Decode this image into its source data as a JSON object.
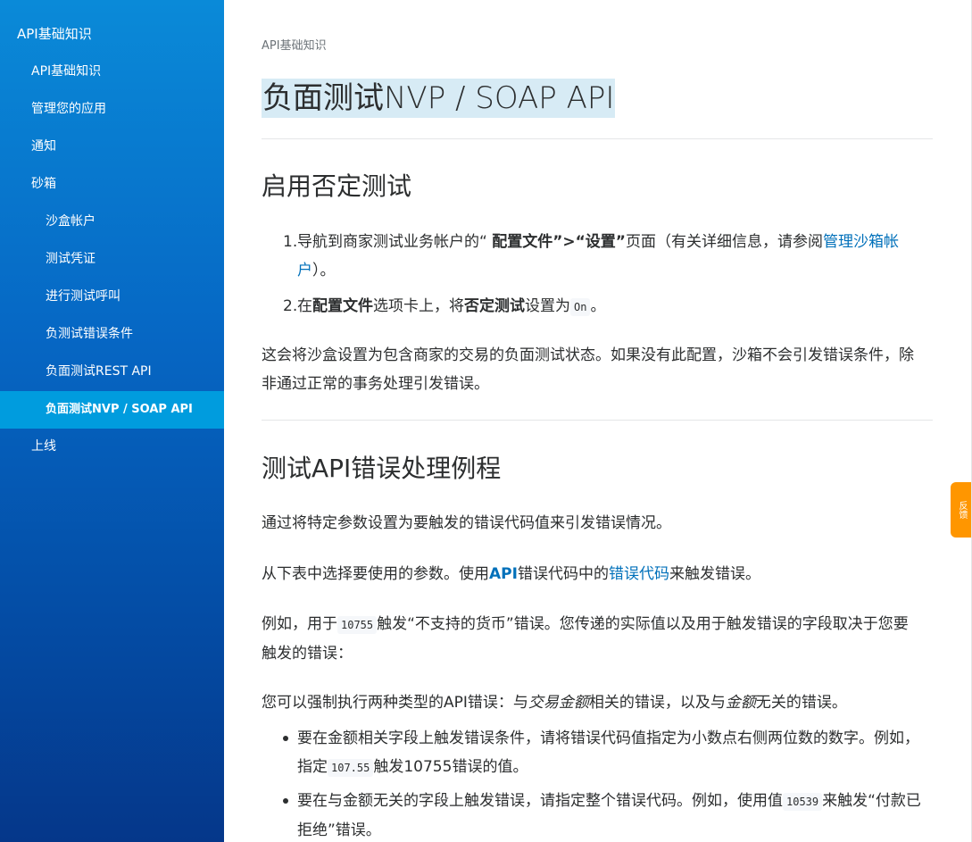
{
  "sidebar": {
    "items": [
      {
        "label": "API基础知识"
      },
      {
        "label": "API基础知识"
      },
      {
        "label": "管理您的应用"
      },
      {
        "label": "通知"
      },
      {
        "label": "砂箱"
      },
      {
        "label": "沙盒帐户"
      },
      {
        "label": "测试凭证"
      },
      {
        "label": "进行测试呼叫"
      },
      {
        "label": "负测试错误条件"
      },
      {
        "label": "负面测试REST API"
      },
      {
        "label": "负面测试NVP / SOAP API"
      },
      {
        "label": "上线"
      }
    ]
  },
  "main": {
    "breadcrumb": "API基础知识",
    "title_cjk": "负面测试",
    "title_en": "NVP / SOAP API",
    "section1": {
      "heading": "启用否定测试",
      "step1": {
        "num": "1.",
        "pre": "导航到商家测试业务帐户的“ ",
        "bold1": "配置文件”>“设置”",
        "mid": "页面（有关详细信息，请参阅",
        "link": "管理沙箱帐户",
        "post": "）。"
      },
      "step2": {
        "num": "2.",
        "pre": "在",
        "bold1": "配置文件",
        "mid": "选项卡上，将",
        "bold2": "否定测试",
        "mid2": "设置为",
        "code": "On",
        "post": "。"
      },
      "note": "这会将沙盒设置为包含商家的交易的负面测试状态。如果没有此配置，沙箱不会引发错误条件，除非通过正常的事务处理引发错误。"
    },
    "section2": {
      "heading": "测试API错误处理例程",
      "p1": "通过将特定参数设置为要触发的错误代码值来引发错误情况。",
      "p2": {
        "pre": "从下表中选择要使用的参数。使用",
        "link1": "API",
        "mid": "错误代码中的",
        "link2": "错误代码",
        "post": "来触发错误。"
      },
      "p3": {
        "pre": "例如，用于",
        "code": "10755",
        "post": "触发“不支持的货币”错误。您传递的实际值以及用于触发错误的字段取决于您要触发的错误："
      },
      "p4": {
        "pre": "您可以强制执行两种类型的API错误：与",
        "italic1": "交易金额",
        "mid": "相关的错误，以及与",
        "italic2": "金额",
        "post": "无关的错误。"
      },
      "bullet1": {
        "pre": "要在金额相关字段上触发错误条件，请将错误代码值指定为小数点右侧两位数的数字。例如，指定",
        "code": "107.55",
        "post": "触发10755错误的值。"
      },
      "bullet2": {
        "pre": "要在与金额无关的字段上触发错误，请指定整个错误代码。例如，使用值",
        "code": "10539",
        "post": "来触发“付款已拒绝”错误。"
      }
    }
  },
  "feedback": {
    "label": "反馈"
  },
  "colors": {
    "sidebar_top": "#0a8ad8",
    "sidebar_bottom": "#05378a",
    "active_item": "#009cde",
    "link": "#0070ba",
    "feedback": "#ff9600",
    "title_highlight": "#d7ebf5"
  }
}
